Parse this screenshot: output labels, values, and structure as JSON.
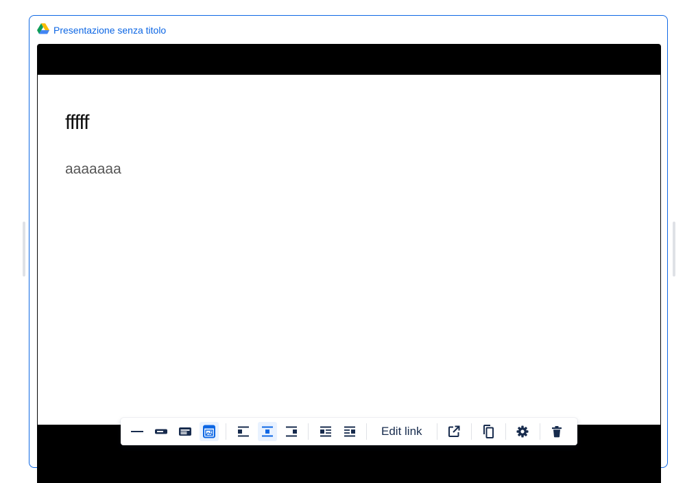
{
  "embed": {
    "title": "Presentazione senza titolo",
    "icon": "google-drive-icon"
  },
  "slide": {
    "title": "fffff",
    "body": "aaaaaaa"
  },
  "toolbar": {
    "layout_buttons": [
      {
        "name": "inline-layout",
        "icon": "smart-link-inline-icon",
        "selected": false
      },
      {
        "name": "block-layout",
        "icon": "smart-link-block-icon",
        "selected": false
      },
      {
        "name": "card-layout",
        "icon": "smart-link-card-icon",
        "selected": false
      },
      {
        "name": "embed-layout",
        "icon": "smart-link-embed-icon",
        "selected": true
      }
    ],
    "align_buttons": [
      {
        "name": "align-start",
        "icon": "align-left-icon",
        "selected": false
      },
      {
        "name": "align-center",
        "icon": "align-center-icon",
        "selected": true
      },
      {
        "name": "align-end",
        "icon": "align-right-icon",
        "selected": false
      }
    ],
    "wrap_buttons": [
      {
        "name": "wrap-left",
        "icon": "wrap-left-icon"
      },
      {
        "name": "wrap-right",
        "icon": "wrap-right-icon"
      }
    ],
    "edit_link_label": "Edit link",
    "accent_color": "#0c66e4",
    "icon_color": "#172b4d",
    "selected_bg": "#e9f2ff"
  }
}
